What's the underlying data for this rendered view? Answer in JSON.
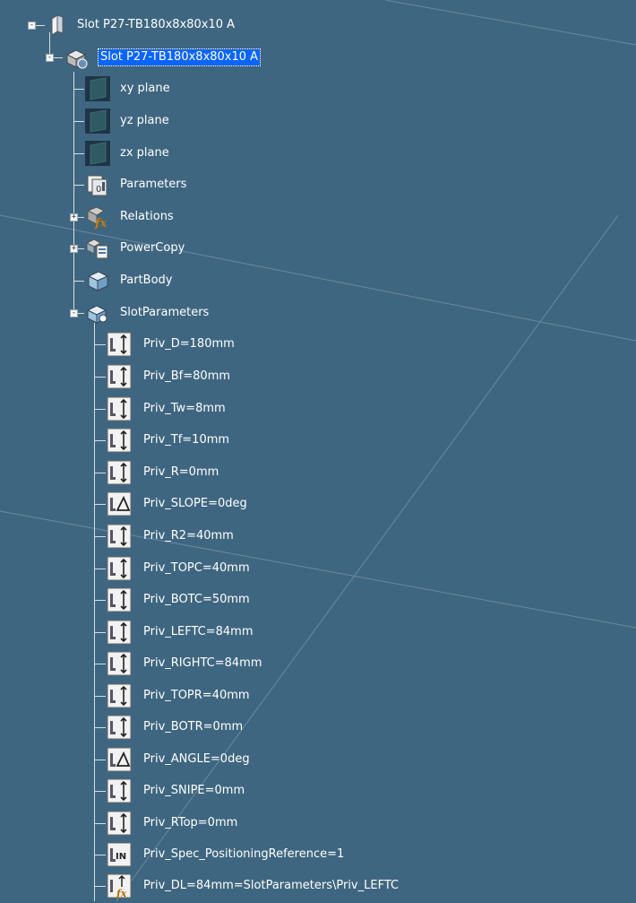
{
  "tree": {
    "root": {
      "label": "Slot P27-TB180x8x80x10 A",
      "icon": "product-icon"
    },
    "part": {
      "label": "Slot P27-TB180x8x80x10 A",
      "icon": "part-icon",
      "selected": true
    },
    "children": [
      {
        "label": "xy plane",
        "icon": "plane-icon"
      },
      {
        "label": "yz plane",
        "icon": "plane-icon"
      },
      {
        "label": "zx plane",
        "icon": "plane-icon"
      },
      {
        "label": "Parameters",
        "icon": "parameters-icon"
      },
      {
        "label": "Relations",
        "icon": "relations-icon",
        "expandable": true
      },
      {
        "label": "PowerCopy",
        "icon": "powercopy-icon",
        "expandable": true
      },
      {
        "label": "PartBody",
        "icon": "partbody-icon"
      },
      {
        "label": "SlotParameters",
        "icon": "parameter-set-icon",
        "expanded": true
      }
    ],
    "slot_parameters": [
      {
        "label": "Priv_D=180mm",
        "icon": "length-parameter-icon"
      },
      {
        "label": "Priv_Bf=80mm",
        "icon": "length-parameter-icon"
      },
      {
        "label": "Priv_Tw=8mm",
        "icon": "length-parameter-icon"
      },
      {
        "label": "Priv_Tf=10mm",
        "icon": "length-parameter-icon"
      },
      {
        "label": "Priv_R=0mm",
        "icon": "length-parameter-icon"
      },
      {
        "label": "Priv_SLOPE=0deg",
        "icon": "angle-parameter-icon"
      },
      {
        "label": "Priv_R2=40mm",
        "icon": "length-parameter-icon"
      },
      {
        "label": "Priv_TOPC=40mm",
        "icon": "length-parameter-icon"
      },
      {
        "label": "Priv_BOTC=50mm",
        "icon": "length-parameter-icon"
      },
      {
        "label": "Priv_LEFTC=84mm",
        "icon": "length-parameter-icon"
      },
      {
        "label": "Priv_RIGHTC=84mm",
        "icon": "length-parameter-icon"
      },
      {
        "label": "Priv_TOPR=40mm",
        "icon": "length-parameter-icon"
      },
      {
        "label": "Priv_BOTR=0mm",
        "icon": "length-parameter-icon"
      },
      {
        "label": "Priv_ANGLE=0deg",
        "icon": "angle-parameter-icon"
      },
      {
        "label": "Priv_SNIPE=0mm",
        "icon": "length-parameter-icon"
      },
      {
        "label": "Priv_RTop=0mm",
        "icon": "length-parameter-icon"
      },
      {
        "label": "Priv_Spec_PositioningReference=1",
        "icon": "integer-parameter-icon"
      },
      {
        "label": "Priv_DL=84mm=SlotParameters\\Priv_LEFTC",
        "icon": "formula-parameter-icon"
      }
    ]
  },
  "colors": {
    "background": "#3f6680",
    "selection": "#0a64ff",
    "tree_line": "#d8dde2"
  }
}
